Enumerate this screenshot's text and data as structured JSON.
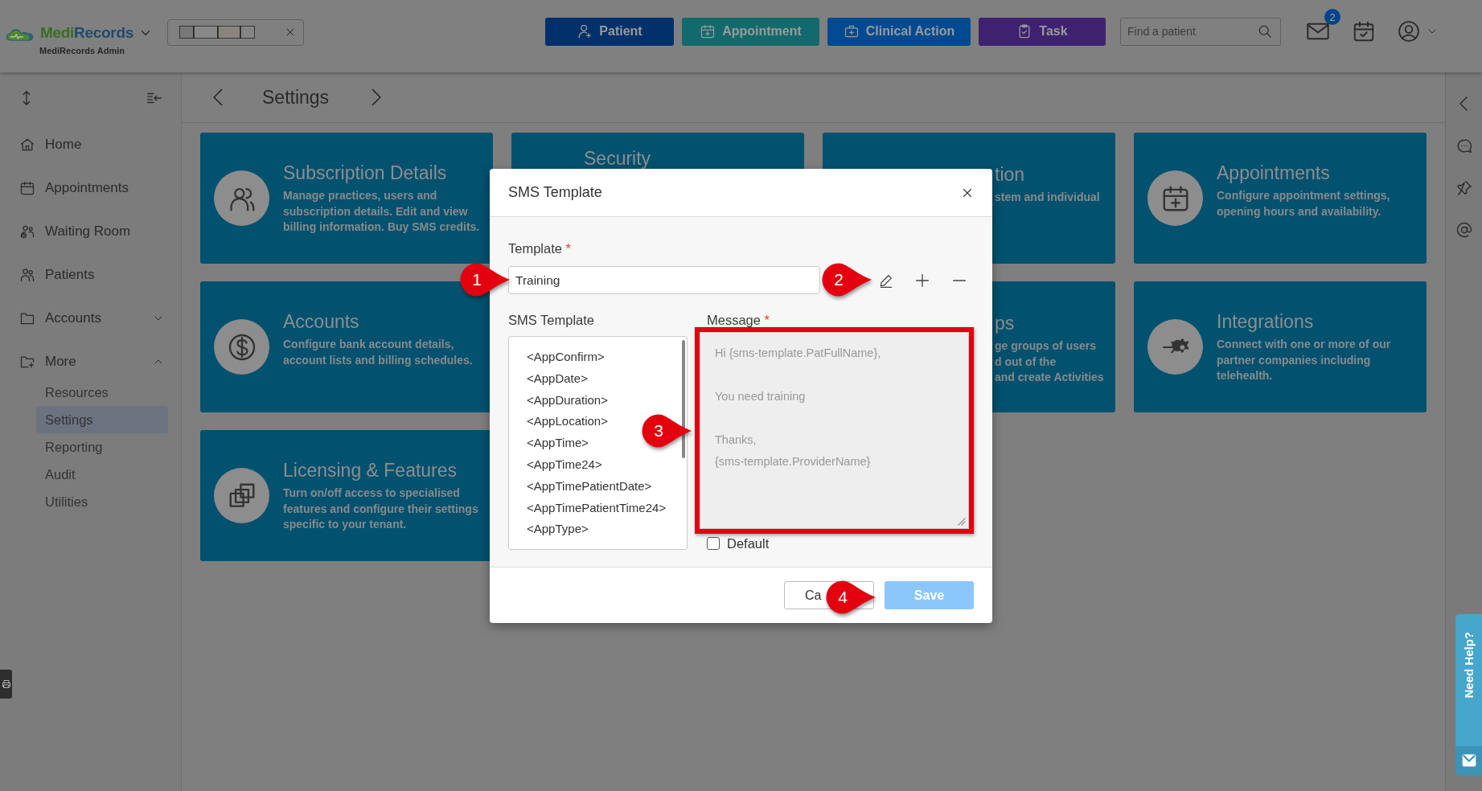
{
  "header": {
    "brand": {
      "first": "Medi",
      "second": "Records"
    },
    "subtitle": "MediRecords Admin",
    "actions": [
      {
        "label": "Patient",
        "color": "#02306a"
      },
      {
        "label": "Appointment",
        "color": "#136a6c"
      },
      {
        "label": "Clinical Action",
        "color": "#014a91"
      },
      {
        "label": "Task",
        "color": "#3e2270"
      }
    ],
    "search": {
      "placeholder": "Find a patient"
    },
    "mail_badge": "2"
  },
  "sidebar": {
    "items": [
      {
        "label": "Home",
        "kind": "link",
        "selected": false
      },
      {
        "label": "Appointments",
        "kind": "link",
        "selected": false
      },
      {
        "label": "Waiting Room",
        "kind": "link",
        "selected": false
      },
      {
        "label": "Patients",
        "kind": "link",
        "selected": false
      },
      {
        "label": "Accounts",
        "kind": "group",
        "expanded": false,
        "selected": false
      },
      {
        "label": "More",
        "kind": "group",
        "expanded": true,
        "selected": false,
        "children": [
          {
            "label": "Resources",
            "selected": false
          },
          {
            "label": "Settings",
            "selected": true
          },
          {
            "label": "Reporting",
            "selected": false
          },
          {
            "label": "Audit",
            "selected": false
          },
          {
            "label": "Utilities",
            "selected": false
          }
        ]
      }
    ]
  },
  "page": {
    "title": "Settings"
  },
  "cards": [
    {
      "kind": "full",
      "title": "Subscription Details",
      "description": "Manage practices, users and subscription details. Edit and view billing information. Buy SMS credits."
    },
    {
      "kind": "top",
      "title": "Security"
    },
    {
      "kind": "right",
      "title": "tion",
      "lines": [
        "stem and individual"
      ]
    },
    {
      "kind": "full",
      "title": "Appointments",
      "description": "Configure appointment settings, opening hours and availability."
    },
    {
      "kind": "full",
      "title": "Accounts",
      "description": "Configure bank account details, account lists and billing schedules."
    },
    {
      "kind": "right",
      "title": "ps",
      "lines": [
        "ge groups of users",
        "d out of the",
        "and create Activities"
      ]
    },
    {
      "kind": "full",
      "title": "Integrations",
      "description": "Connect with one or more of our partner companies including telehealth."
    },
    {
      "kind": "full",
      "title": "Licensing & Features",
      "description": "Turn on/off access to specialised features and configure their settings specific to your tenant."
    }
  ],
  "rail": {
    "help_label": "Need Help?"
  },
  "dialog": {
    "title": "SMS Template",
    "template_field": {
      "label": "Template",
      "required_mark": "*",
      "value": "Training"
    },
    "variables": {
      "label": "SMS Template",
      "items": [
        "<AppConfirm>",
        "<AppDate>",
        "<AppDuration>",
        "<AppLocation>",
        "<AppTime>",
        "<AppTime24>",
        "<AppTimePatientDate>",
        "<AppTimePatientTime24>",
        "<AppType>"
      ]
    },
    "message": {
      "label": "Message",
      "required_mark": "*",
      "value": "Hi {sms-template.PatFullName},\n\nYou need training\n\nThanks,\n{sms-template.ProviderName}",
      "disabled": true,
      "highlighted": true
    },
    "default_checkbox": {
      "label": "Default",
      "checked": false
    },
    "buttons": [
      {
        "label": "Ca",
        "kind": "secondary",
        "disabled": false
      },
      {
        "label": "Save",
        "kind": "primary",
        "disabled": true
      }
    ]
  },
  "annotations": {
    "markers": [
      {
        "label": "1"
      },
      {
        "label": "2"
      },
      {
        "label": "3"
      },
      {
        "label": "4"
      }
    ]
  }
}
